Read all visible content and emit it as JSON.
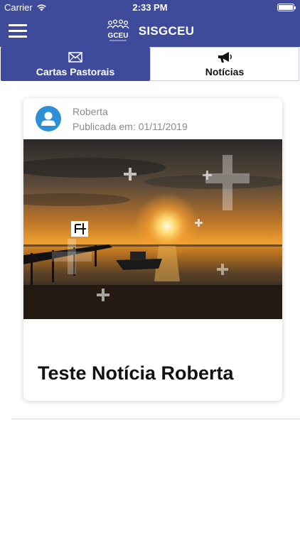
{
  "status_bar": {
    "carrier": "Carrier",
    "time": "2:33 PM",
    "wifi_icon": "wifi-icon",
    "battery_icon": "battery-icon"
  },
  "nav": {
    "menu_icon": "hamburger-menu-icon",
    "logo_text": "GCEU",
    "title": "SISGCEU"
  },
  "tabs": [
    {
      "label": "Cartas Pastorais",
      "icon": "envelope-icon",
      "active": true
    },
    {
      "label": "Notícias",
      "icon": "megaphone-icon",
      "active": false
    }
  ],
  "news": [
    {
      "author": "Roberta",
      "published_label": "Publicada em:",
      "published_date": "01/11/2019",
      "avatar_icon": "user-avatar-icon",
      "image": "sunset-pier-photo",
      "title": "Teste Notícia Roberta"
    }
  ],
  "colors": {
    "primary": "#3e4a9a",
    "avatar": "#2d8fd6",
    "muted_text": "#8a8a8a"
  }
}
